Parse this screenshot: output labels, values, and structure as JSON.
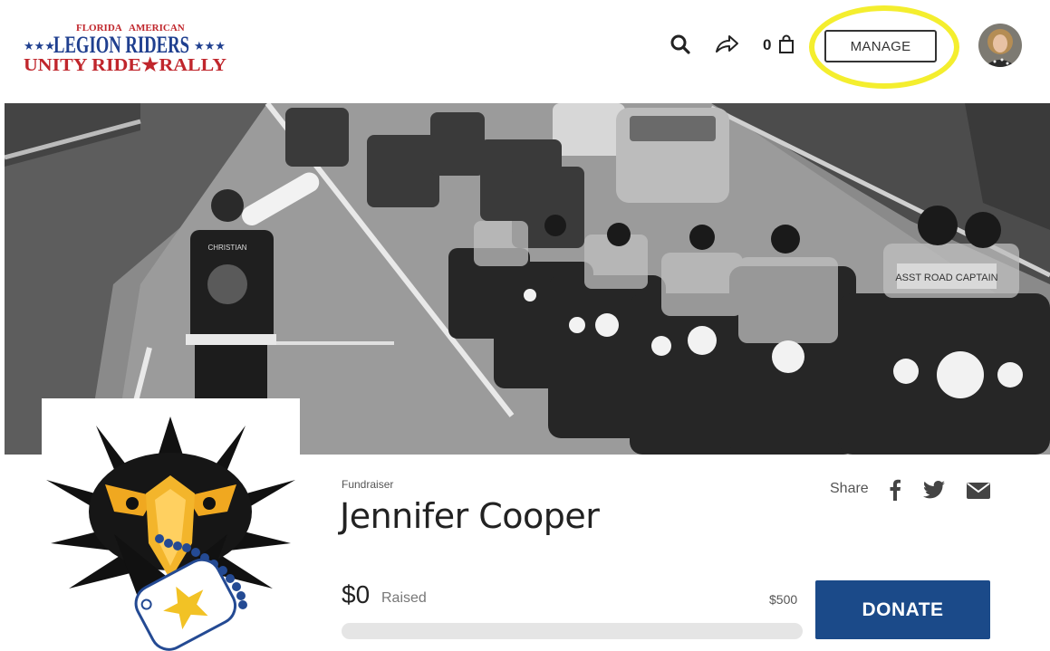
{
  "header": {
    "logo": {
      "line_top_left": "FLORIDA",
      "line_top_right": "AMERICAN",
      "line_main": "LEGION RIDERS",
      "line_bottom": "UNITY RIDE★RALLY",
      "stars": "★★★"
    },
    "icons": [
      "search-icon",
      "share-arrow-icon",
      "shopping-bag-icon"
    ],
    "cart_count": "0",
    "manage_label": "MANAGE",
    "highlight_color": "#f4ee2e"
  },
  "banner": {
    "vest_text": "CHRISTIAN",
    "windshield_text": "ASST ROAD CAPTAIN"
  },
  "profile": {
    "kicker": "Fundraiser",
    "name": "Jennifer Cooper"
  },
  "share": {
    "label": "Share",
    "icons": [
      "facebook-icon",
      "twitter-icon",
      "email-icon"
    ]
  },
  "fundraising": {
    "raised_amount": "$0",
    "raised_label": "Raised",
    "goal": "$500",
    "progress_fraction": 0,
    "donate_label": "DONATE"
  },
  "colors": {
    "brand_blue": "#1b4a89",
    "logo_red": "#c0262c",
    "logo_blue": "#1f3f8f"
  }
}
